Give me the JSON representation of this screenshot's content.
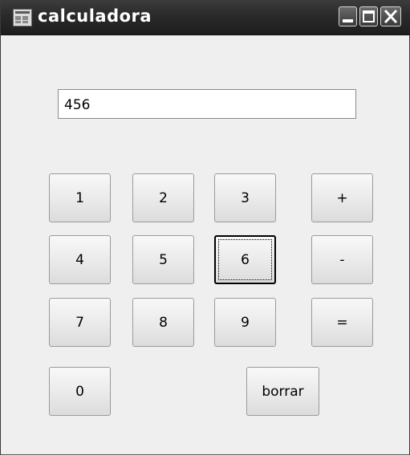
{
  "window": {
    "title": "calculadora",
    "controls": {
      "minimize": "minimize-icon",
      "maximize": "maximize-icon",
      "close": "close-icon"
    }
  },
  "display": {
    "value": "456"
  },
  "keys": {
    "k1": "1",
    "k2": "2",
    "k3": "3",
    "plus": "+",
    "k4": "4",
    "k5": "5",
    "k6": "6",
    "minus": "-",
    "k7": "7",
    "k8": "8",
    "k9": "9",
    "equals": "=",
    "k0": "0",
    "clear": "borrar"
  },
  "state": {
    "focused_key": "6"
  }
}
